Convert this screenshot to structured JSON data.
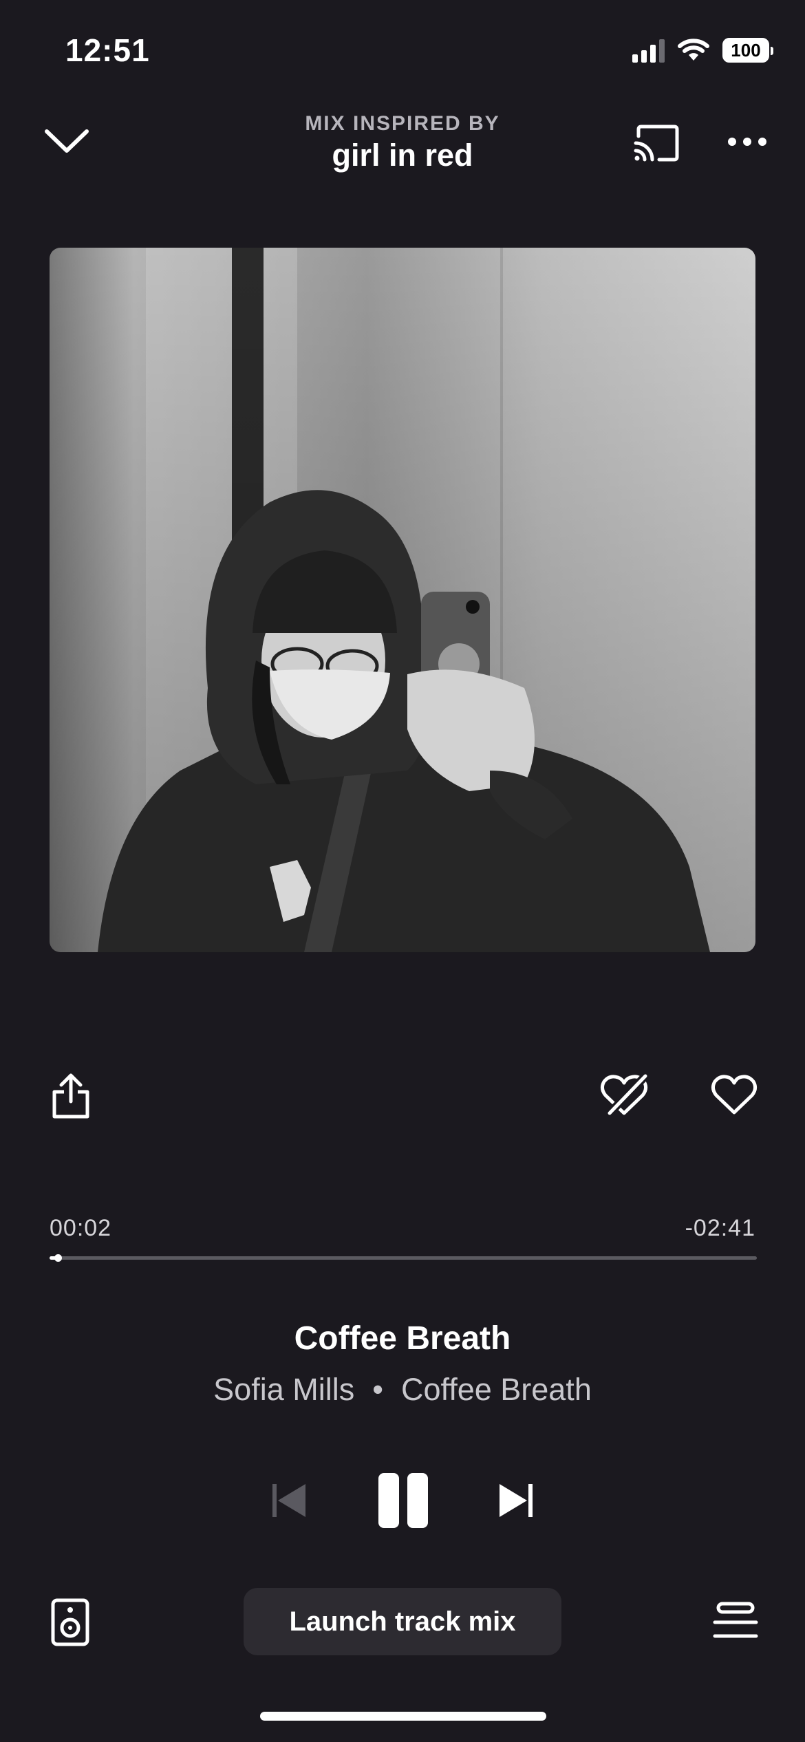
{
  "status_bar": {
    "time": "12:51",
    "battery": "100"
  },
  "header": {
    "kicker": "MIX INSPIRED BY",
    "title": "girl in red"
  },
  "artwork": {
    "description_icon": "album-artwork"
  },
  "progress": {
    "elapsed": "00:02",
    "remaining": "-02:41",
    "fraction": 0.012
  },
  "song": {
    "title": "Coffee Breath",
    "artist": "Sofia Mills",
    "separator": "•",
    "album": "Coffee Breath"
  },
  "actions": {
    "launch_label": "Launch track mix"
  },
  "icons": {
    "collapse": "chevron-down-icon",
    "cast": "cast-icon",
    "more": "more-icon",
    "share": "share-icon",
    "dislike": "heart-slash-icon",
    "like": "heart-icon",
    "previous": "previous-icon",
    "pause": "pause-icon",
    "next": "next-icon",
    "speaker": "speaker-icon",
    "queue": "queue-icon"
  },
  "colors": {
    "background": "#1b191f",
    "button_bg": "#2d2b31",
    "secondary_text": "#c8c7cc",
    "disabled": "#5a5960"
  }
}
